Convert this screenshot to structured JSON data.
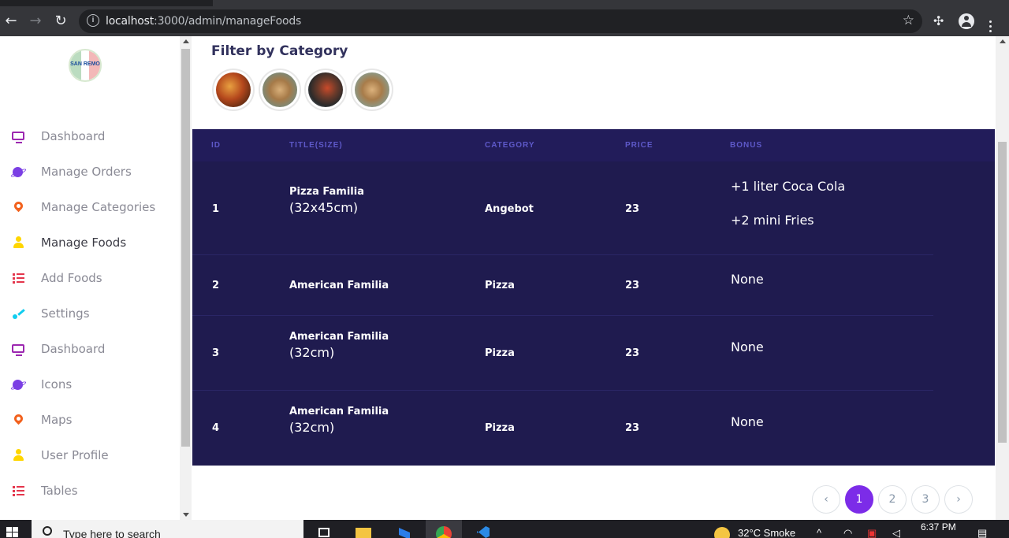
{
  "browser": {
    "url_host": "localhost",
    "url_rest": ":3000/admin/manageFoods"
  },
  "sidebar": {
    "logo_text": "SAN REMO",
    "items": [
      {
        "label": "Dashboard",
        "icon": "monitor-icon",
        "active": false
      },
      {
        "label": "Manage Orders",
        "icon": "planet-icon",
        "active": false
      },
      {
        "label": "Manage Categories",
        "icon": "pin-icon",
        "active": false
      },
      {
        "label": "Manage Foods",
        "icon": "user-icon",
        "active": true
      },
      {
        "label": "Add Foods",
        "icon": "list-icon",
        "active": false
      },
      {
        "label": "Settings",
        "icon": "pen-icon",
        "active": false
      },
      {
        "label": "Dashboard",
        "icon": "monitor-icon",
        "active": false
      },
      {
        "label": "Icons",
        "icon": "planet-icon",
        "active": false
      },
      {
        "label": "Maps",
        "icon": "pin-icon",
        "active": false
      },
      {
        "label": "User Profile",
        "icon": "user-icon",
        "active": false
      },
      {
        "label": "Tables",
        "icon": "list-icon",
        "active": false
      }
    ]
  },
  "filter": {
    "title": "Filter by Category",
    "categories": [
      "category-1",
      "category-2",
      "category-3",
      "category-4"
    ]
  },
  "table": {
    "headers": {
      "id": "ID",
      "title": "TITLE(SIZE)",
      "category": "CATEGORY",
      "price": "PRICE",
      "bonus": "BONUS"
    },
    "rows": [
      {
        "id": "1",
        "name": "Pizza Familia",
        "size": "(32x45cm)",
        "category": "Angebot",
        "price": "23",
        "bonus": [
          "+1 liter Coca Cola",
          "+2 mini Fries"
        ]
      },
      {
        "id": "2",
        "name": "American Familia",
        "size": "",
        "category": "Pizza",
        "price": "23",
        "bonus": [
          "None"
        ]
      },
      {
        "id": "3",
        "name": "American Familia",
        "size": "(32cm)",
        "category": "Pizza",
        "price": "23",
        "bonus": [
          "None"
        ]
      },
      {
        "id": "4",
        "name": "American Familia",
        "size": "(32cm)",
        "category": "Pizza",
        "price": "23",
        "bonus": [
          "None"
        ]
      }
    ]
  },
  "pagination": {
    "prev": "‹",
    "pages": [
      "1",
      "2",
      "3"
    ],
    "active_page": "1",
    "next": "›"
  },
  "taskbar": {
    "search_placeholder": "Type here to search",
    "weather": "32°C  Smoke",
    "time": "6:37 PM"
  },
  "colors": {
    "table_bg": "#1f1b4f",
    "header_text": "#5e59c9",
    "accent": "#7c2ce8"
  }
}
